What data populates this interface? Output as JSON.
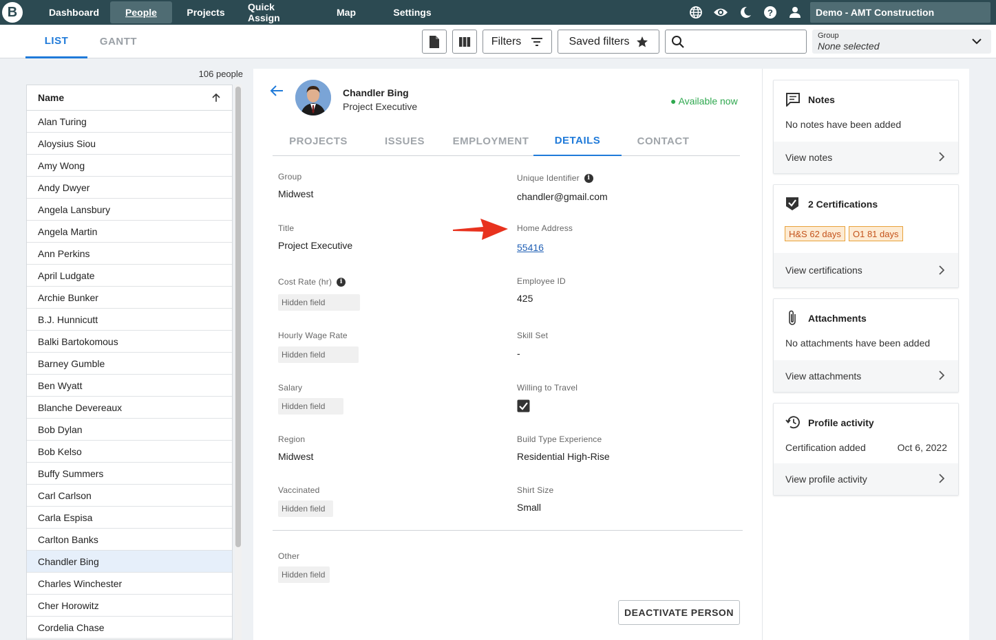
{
  "nav": {
    "logo": "B",
    "items": [
      "Dashboard",
      "People",
      "Projects",
      "Quick Assign",
      "Map",
      "Settings"
    ],
    "active": "People",
    "account": "Demo - AMT Construction",
    "icons": [
      "globe-icon",
      "eye-icon",
      "moon-icon",
      "help-icon",
      "user-icon"
    ]
  },
  "toolbar": {
    "tabs": [
      "LIST",
      "GANTT"
    ],
    "active_tab": "LIST",
    "filters_label": "Filters",
    "saved_filters_label": "Saved filters",
    "search_placeholder": "",
    "group_label": "Group",
    "group_value": "None selected"
  },
  "people": {
    "count_label": "106 people",
    "header": "Name",
    "selected": "Chandler Bing",
    "names": [
      "Alan Turing",
      "Aloysius Siou",
      "Amy Wong",
      "Andy Dwyer",
      "Angela Lansbury",
      "Angela Martin",
      "Ann Perkins",
      "April Ludgate",
      "Archie Bunker",
      "B.J. Hunnicutt",
      "Balki Bartokomous",
      "Barney Gumble",
      "Ben Wyatt",
      "Blanche Devereaux",
      "Bob Dylan",
      "Bob Kelso",
      "Buffy Summers",
      "Carl Carlson",
      "Carla Espisa",
      "Carlton Banks",
      "Chandler Bing",
      "Charles Winchester",
      "Cher Horowitz",
      "Cordelia Chase"
    ]
  },
  "person": {
    "name": "Chandler Bing",
    "title": "Project Executive",
    "status": "● Available now",
    "status_color": "#2fa84f",
    "tabs": [
      "PROJECTS",
      "ISSUES",
      "EMPLOYMENT",
      "DETAILS",
      "CONTACT"
    ],
    "active_tab": "DETAILS"
  },
  "details": {
    "group_label": "Group",
    "group_value": "Midwest",
    "uid_label": "Unique Identifier",
    "uid_value": "chandler@gmail.com",
    "title_label": "Title",
    "title_value": "Project Executive",
    "address_label": "Home Address",
    "address_value": "55416",
    "cost_label": "Cost Rate (hr)",
    "cost_value": "Hidden field",
    "empid_label": "Employee ID",
    "empid_value": "425",
    "hourly_label": "Hourly Wage Rate",
    "hourly_value": "Hidden field",
    "skill_label": "Skill Set",
    "skill_value": "-",
    "salary_label": "Salary",
    "salary_value": "Hidden field",
    "travel_label": "Willing to Travel",
    "travel_checked": true,
    "region_label": "Region",
    "region_value": "Midwest",
    "build_label": "Build Type Experience",
    "build_value": "Residential High-Rise",
    "vacc_label": "Vaccinated",
    "vacc_value": "Hidden field",
    "shirt_label": "Shirt Size",
    "shirt_value": "Small",
    "other_label": "Other",
    "other_value": "Hidden field",
    "deactivate_label": "DEACTIVATE PERSON"
  },
  "cards": {
    "notes": {
      "title": "Notes",
      "text": "No notes have been added",
      "link": "View notes"
    },
    "certs": {
      "title": "2 Certifications",
      "badges": [
        "H&S 62 days",
        "O1 81 days"
      ],
      "link": "View certifications"
    },
    "attach": {
      "title": "Attachments",
      "text": "No attachments have been added",
      "link": "View attachments"
    },
    "activity": {
      "title": "Profile activity",
      "event": "Certification added",
      "date": "Oct 6, 2022",
      "link": "View profile activity"
    }
  },
  "colors": {
    "nav_bg": "#2c4a52",
    "accent": "#1f7ad9",
    "arrow": "#e8321e",
    "badge_border": "#e8a13a"
  }
}
